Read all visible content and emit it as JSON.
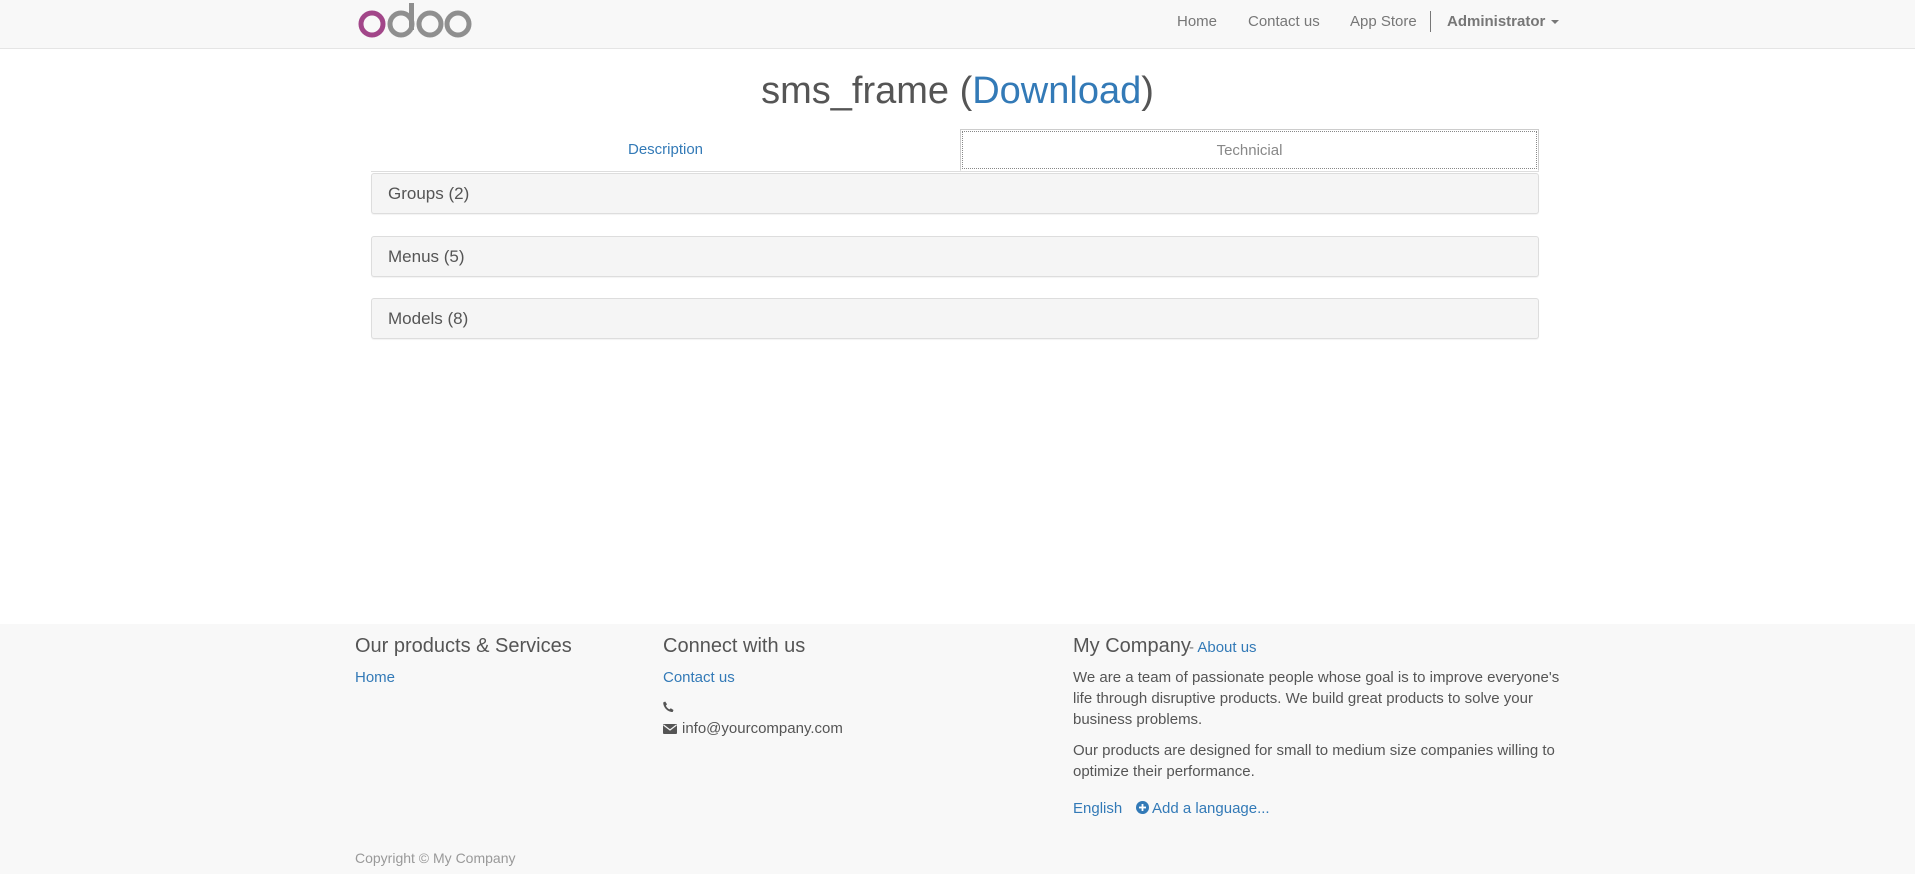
{
  "nav": {
    "logo_text": "odoo",
    "home": "Home",
    "contact": "Contact us",
    "app_store": "App Store",
    "user": "Administrator"
  },
  "title": {
    "module_name": "sms_frame",
    "open_paren": " (",
    "download": "Download",
    "close_paren": ")"
  },
  "tabs": [
    {
      "label": "Description",
      "active": false
    },
    {
      "label": "Technicial",
      "active": true
    }
  ],
  "panels": [
    {
      "label": "Groups (2)"
    },
    {
      "label": "Menus (5)"
    },
    {
      "label": "Models (8)"
    }
  ],
  "footer": {
    "products": {
      "heading": "Our products & Services",
      "home": "Home"
    },
    "connect": {
      "heading": "Connect with us",
      "contact": "Contact us",
      "phone": "",
      "email": "info@yourcompany.com"
    },
    "company": {
      "heading": "My Company",
      "about_dash": "- ",
      "about": "About us",
      "paragraph1": "We are a team of passionate people whose goal is to improve everyone's life through disruptive products. We build great products to solve your business problems.",
      "paragraph2": "Our products are designed for small to medium size companies willing to optimize their performance.",
      "language": "English",
      "add_language": "Add a language..."
    },
    "copyright": "Copyright © My Company"
  },
  "colors": {
    "link": "#337ab7",
    "logo_o": "#a24689",
    "logo_rest": "#8f8f8f",
    "footer_bg": "#f8f8f8",
    "panel_bg": "#f5f5f5"
  },
  "icons": [
    "phone-icon",
    "envelope-icon",
    "plus-circle-icon",
    "caret-down-icon"
  ]
}
